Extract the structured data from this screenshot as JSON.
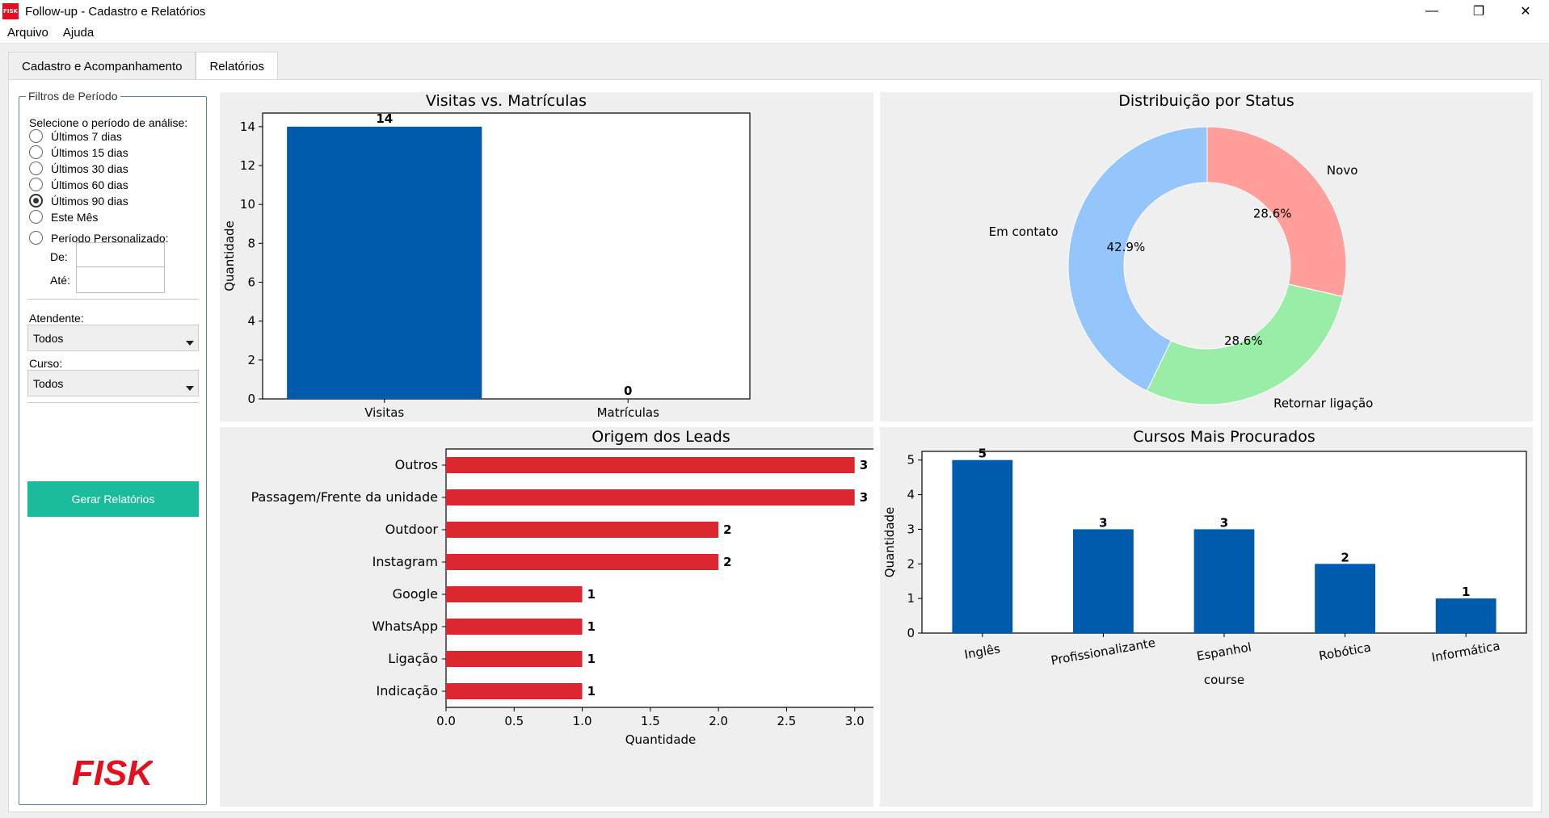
{
  "window": {
    "title": "Follow-up - Cadastro e Relatórios",
    "icon_text": "FISK",
    "controls": {
      "minimize": "—",
      "maximize": "❐",
      "close": "✕"
    }
  },
  "menu": {
    "items": [
      "Arquivo",
      "Ajuda"
    ]
  },
  "tabs": [
    {
      "label": "Cadastro e Acompanhamento",
      "active": false
    },
    {
      "label": "Relatórios",
      "active": true
    }
  ],
  "filters": {
    "legend": "Filtros de Período",
    "prompt": "Selecione o período de análise:",
    "options": [
      {
        "label": "Últimos 7 dias",
        "checked": false
      },
      {
        "label": "Últimos 15 dias",
        "checked": false
      },
      {
        "label": "Últimos 30 dias",
        "checked": false
      },
      {
        "label": "Últimos 60 dias",
        "checked": false
      },
      {
        "label": "Últimos 90 dias",
        "checked": true
      },
      {
        "label": "Este Mês",
        "checked": false
      },
      {
        "label": "Período Personalizado:",
        "checked": false
      }
    ],
    "from_label": "De:",
    "to_label": "Até:",
    "from_value": "",
    "to_value": "",
    "attendant_label": "Atendente:",
    "attendant_value": "Todos",
    "course_label": "Curso:",
    "course_value": "Todos",
    "generate_button": "Gerar Relatórios",
    "generate_color": "#1abc9c",
    "logo_text": "FISK",
    "logo_color": "#e3101f"
  },
  "chart_data": [
    {
      "id": "visits",
      "type": "bar",
      "title": "Visitas vs. Matrículas",
      "categories": [
        "Visitas",
        "Matrículas"
      ],
      "values": [
        14,
        0
      ],
      "ylabel": "Quantidade",
      "xlabel": "",
      "ylim": [
        0,
        14.7
      ],
      "yticks": [
        0,
        2,
        4,
        6,
        8,
        10,
        12,
        14
      ],
      "color": "#005bac",
      "grid": false
    },
    {
      "id": "status",
      "type": "pie",
      "title": "Distribuição por Status",
      "donut": true,
      "slices": [
        {
          "label": "Novo",
          "value": 28.6,
          "pct": "28.6%",
          "color": "#ff9e9a"
        },
        {
          "label": "Retornar ligação",
          "value": 28.6,
          "pct": "28.6%",
          "color": "#99eda6"
        },
        {
          "label": "Em contato",
          "value": 42.9,
          "pct": "42.9%",
          "color": "#94c6fb"
        }
      ]
    },
    {
      "id": "origin",
      "type": "bar",
      "orientation": "horizontal",
      "title": "Origem dos Leads",
      "categories": [
        "Outros",
        "Passagem/Frente da unidade",
        "Outdoor",
        "Instagram",
        "Google",
        "WhatsApp",
        "Ligação",
        "Indicação"
      ],
      "values": [
        3,
        3,
        2,
        2,
        1,
        1,
        1,
        1
      ],
      "xlabel": "Quantidade",
      "xlim": [
        0,
        3.15
      ],
      "xticks": [
        "0.0",
        "0.5",
        "1.0",
        "1.5",
        "2.0",
        "2.5",
        "3.0"
      ],
      "color": "#dc2630",
      "grid": false
    },
    {
      "id": "courses",
      "type": "bar",
      "title": "Cursos Mais Procurados",
      "categories": [
        "Inglês",
        "Profissionalizante",
        "Espanhol",
        "Robótica",
        "Informática"
      ],
      "values": [
        5,
        3,
        3,
        2,
        1
      ],
      "xlabel": "course",
      "ylabel": "Quantidade",
      "ylim": [
        0,
        5.25
      ],
      "yticks": [
        0,
        1,
        2,
        3,
        4,
        5
      ],
      "color": "#005bac",
      "grid": false
    }
  ]
}
